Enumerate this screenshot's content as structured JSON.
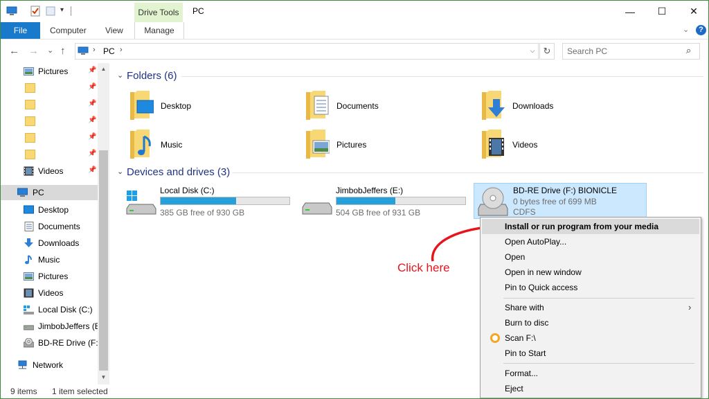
{
  "window": {
    "title": "PC",
    "contextual_tab_group": "Drive Tools",
    "minimize_glyph": "—",
    "maximize_glyph": "☐",
    "close_glyph": "✕",
    "qat_dropdown_glyph": "▾"
  },
  "ribbon": {
    "file": "File",
    "computer": "Computer",
    "view": "View",
    "manage": "Manage",
    "expand_glyph": "⌄",
    "help_glyph": "?"
  },
  "nav": {
    "back_glyph": "←",
    "forward_glyph": "→",
    "recent_glyph": "⌄",
    "up_glyph": "↑",
    "address_sep_glyph": "›",
    "address_text": "PC",
    "address_dropdown_glyph": "⌵",
    "refresh_glyph": "↻",
    "search_placeholder": "Search PC",
    "search_glyph": "⌕"
  },
  "sidebar": {
    "pin_glyph": "📌",
    "quick_access": [
      {
        "label": "Pictures",
        "icon": "pictures-icon"
      },
      {
        "label": "",
        "icon": "folder-icon"
      },
      {
        "label": "",
        "icon": "folder-icon"
      },
      {
        "label": "",
        "icon": "folder-icon"
      },
      {
        "label": "",
        "icon": "folder-icon"
      },
      {
        "label": "",
        "icon": "folder-icon"
      },
      {
        "label": "Videos",
        "icon": "videos-icon"
      }
    ],
    "pc_label": "PC",
    "pc_items": [
      {
        "label": "Desktop",
        "icon": "desktop-icon"
      },
      {
        "label": "Documents",
        "icon": "documents-icon"
      },
      {
        "label": "Downloads",
        "icon": "downloads-icon"
      },
      {
        "label": "Music",
        "icon": "music-icon"
      },
      {
        "label": "Pictures",
        "icon": "pictures-icon"
      },
      {
        "label": "Videos",
        "icon": "videos-icon"
      },
      {
        "label": "Local Disk (C:)",
        "icon": "drive-icon"
      },
      {
        "label": "JimbobJeffers (E",
        "icon": "drive-icon"
      },
      {
        "label": "BD-RE Drive (F:)",
        "icon": "optical-drive-icon"
      }
    ],
    "network_label": "Network",
    "scroll_up_glyph": "▲",
    "scroll_down_glyph": "▼"
  },
  "folders_section": {
    "header": "Folders (6)",
    "chevron_glyph": "⌄",
    "items": [
      {
        "label": "Desktop",
        "icon": "desktop-folder-icon"
      },
      {
        "label": "Documents",
        "icon": "documents-folder-icon"
      },
      {
        "label": "Downloads",
        "icon": "downloads-folder-icon"
      },
      {
        "label": "Music",
        "icon": "music-folder-icon"
      },
      {
        "label": "Pictures",
        "icon": "pictures-folder-icon"
      },
      {
        "label": "Videos",
        "icon": "videos-folder-icon"
      }
    ]
  },
  "drives_section": {
    "header": "Devices and drives (3)",
    "chevron_glyph": "⌄",
    "drives": [
      {
        "name": "Local Disk (C:)",
        "free": "385 GB free of 930 GB",
        "used_fraction": 0.586,
        "bar_color": "#26a0da"
      },
      {
        "name": "JimbobJeffers (E:)",
        "free": "504 GB free of 931 GB",
        "used_fraction": 0.459,
        "bar_color": "#26a0da"
      },
      {
        "name": "BD-RE Drive (F:) BIONICLE",
        "free": "0 bytes free of 699 MB",
        "fs": "CDFS"
      }
    ]
  },
  "status": {
    "items": "9 items",
    "selected": "1 item selected"
  },
  "context_menu": {
    "items": [
      {
        "label": "Install or run program from your media",
        "highlighted": true
      },
      {
        "label": "Open AutoPlay..."
      },
      {
        "label": "Open"
      },
      {
        "label": "Open in new window"
      },
      {
        "label": "Pin to Quick access"
      },
      {
        "label": "Share with",
        "submenu": true
      },
      {
        "label": "Burn to disc"
      },
      {
        "label": "Scan F:\\",
        "icon": "antivirus-scan-icon"
      },
      {
        "label": "Pin to Start"
      },
      {
        "label": "Format..."
      },
      {
        "label": "Eject"
      }
    ],
    "submenu_glyph": "›"
  },
  "annotation": {
    "text": "Click here",
    "color": "#e8141c"
  }
}
